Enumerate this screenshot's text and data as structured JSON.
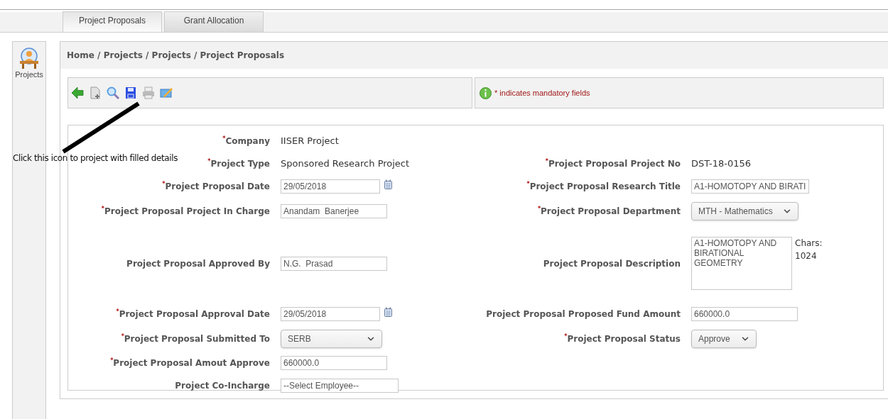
{
  "tabs": [
    {
      "label": "Project Proposals",
      "selected": true
    },
    {
      "label": "Grant Allocation",
      "selected": false
    }
  ],
  "sidebar": {
    "items": [
      {
        "label": "Projects"
      }
    ]
  },
  "breadcrumb": "Home / Projects / Projects / Project Proposals",
  "notice": "* indicates mandatory fields",
  "annotation": "Click this icon to project with filled details",
  "form": {
    "rows": [
      {
        "left": {
          "label": "Company",
          "mark": "*",
          "kind": "text",
          "value": "IISER Project"
        }
      },
      {
        "left": {
          "label": "Project Type",
          "mark": "*",
          "kind": "text",
          "value": "Sponsored Research Project"
        },
        "right": {
          "label": "Project Proposal Project No",
          "mark": "*",
          "kind": "text",
          "value": "DST-18-0156"
        }
      },
      {
        "left": {
          "label": "Project Proposal Date",
          "mark": "*",
          "kind": "date",
          "value": "29/05/2018"
        },
        "right": {
          "label": "Project Proposal Research Title",
          "mark": "*",
          "kind": "input",
          "value": "A1-HOMOTOPY AND BIRATI"
        }
      },
      {
        "left": {
          "label": "Project Proposal Project In Charge",
          "mark": "*",
          "kind": "input",
          "value": "Anandam  Banerjee"
        },
        "right": {
          "label": "Project Proposal Department",
          "mark": "*",
          "kind": "select",
          "value": "MTH - Mathematics"
        }
      },
      {
        "left": {
          "label": "Project Proposal Approved By",
          "kind": "input",
          "value": "N.G.  Prasad"
        },
        "right": {
          "label": "Project Proposal Description",
          "kind": "textarea",
          "value": "A1-HOMOTOPY AND BIRATIONAL GEOMETRY",
          "counter": "Chars: 1024"
        }
      },
      {
        "left": {
          "label": "Project Proposal Approval Date",
          "mark": "*",
          "kind": "date",
          "value": "29/05/2018"
        },
        "right": {
          "label": "Project Proposal Proposed Fund Amount",
          "kind": "input",
          "value": "660000.0"
        }
      },
      {
        "left": {
          "label": "Project Proposal Submitted To",
          "mark": "*",
          "kind": "select",
          "value": "SERB"
        },
        "right": {
          "label": "Project Proposal Status",
          "mark": "*",
          "kind": "select",
          "value": "Approve"
        }
      },
      {
        "left": {
          "label": "Project Proposal Amout Approve",
          "mark": "*",
          "kind": "input",
          "value": "660000.0"
        }
      },
      {
        "left": {
          "label": "Project Co-Incharge",
          "kind": "input",
          "value": "--Select Employee--"
        }
      }
    ]
  }
}
